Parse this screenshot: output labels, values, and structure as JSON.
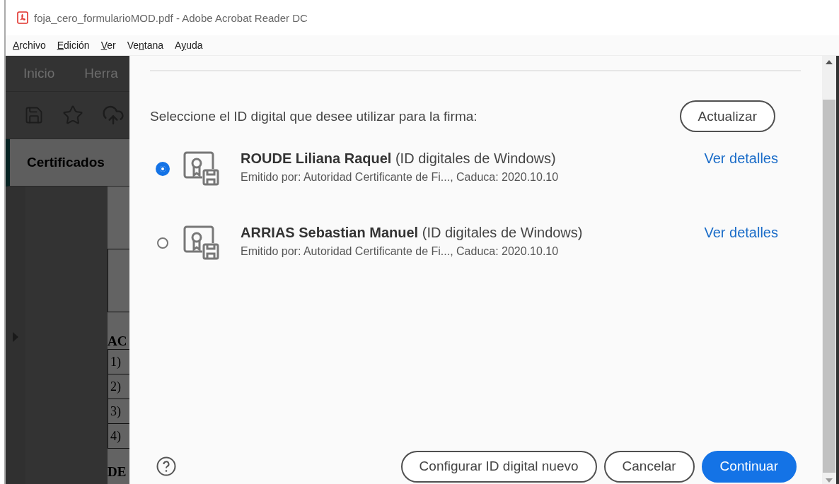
{
  "window": {
    "title": "foja_cero_formularioMOD.pdf - Adobe Acrobat Reader DC"
  },
  "menu": [
    {
      "access_key": "A",
      "rest": "rchivo"
    },
    {
      "access_key": "E",
      "rest": "dición"
    },
    {
      "access_key": "V",
      "rest": "er"
    },
    {
      "lead": "Ve",
      "access_key": "n",
      "rest": "tana"
    },
    {
      "lead": "A",
      "access_key": "y",
      "rest": "uda"
    }
  ],
  "background_app": {
    "tabs": [
      "Inicio",
      "Herra"
    ],
    "tool_panel": {
      "title": "Certificados"
    },
    "document": {
      "heading_1": "AC",
      "list_items": [
        "1)",
        "2)",
        "3)",
        "4)"
      ],
      "heading_2": "DE"
    }
  },
  "dialog": {
    "prompt": "Seleccione el ID digital que desee utilizar para la firma:",
    "refresh_button": "Actualizar",
    "ids": [
      {
        "name": "**ROUDE Liliana Raquel** (ID digitales de Windows)",
        "issuer": "Emitido por: Autoridad Certificante de Fi..., Caduca: 2020.10.10",
        "details_link": "Ver detalles",
        "selected": true
      },
      {
        "name": "**ARRIAS Sebastian Manuel** (ID digitales de Windows)",
        "issuer": "Emitido por: Autoridad Certificante de Fi..., Caduca: 2020.10.10",
        "details_link": "Ver detalles",
        "selected": false
      }
    ],
    "buttons": [
      {
        "label": "Configurar ID digital nuevo",
        "kind": "secondary"
      },
      {
        "label": "Cancelar",
        "kind": "secondary"
      },
      {
        "label": "Continuar",
        "kind": "primary"
      }
    ]
  }
}
